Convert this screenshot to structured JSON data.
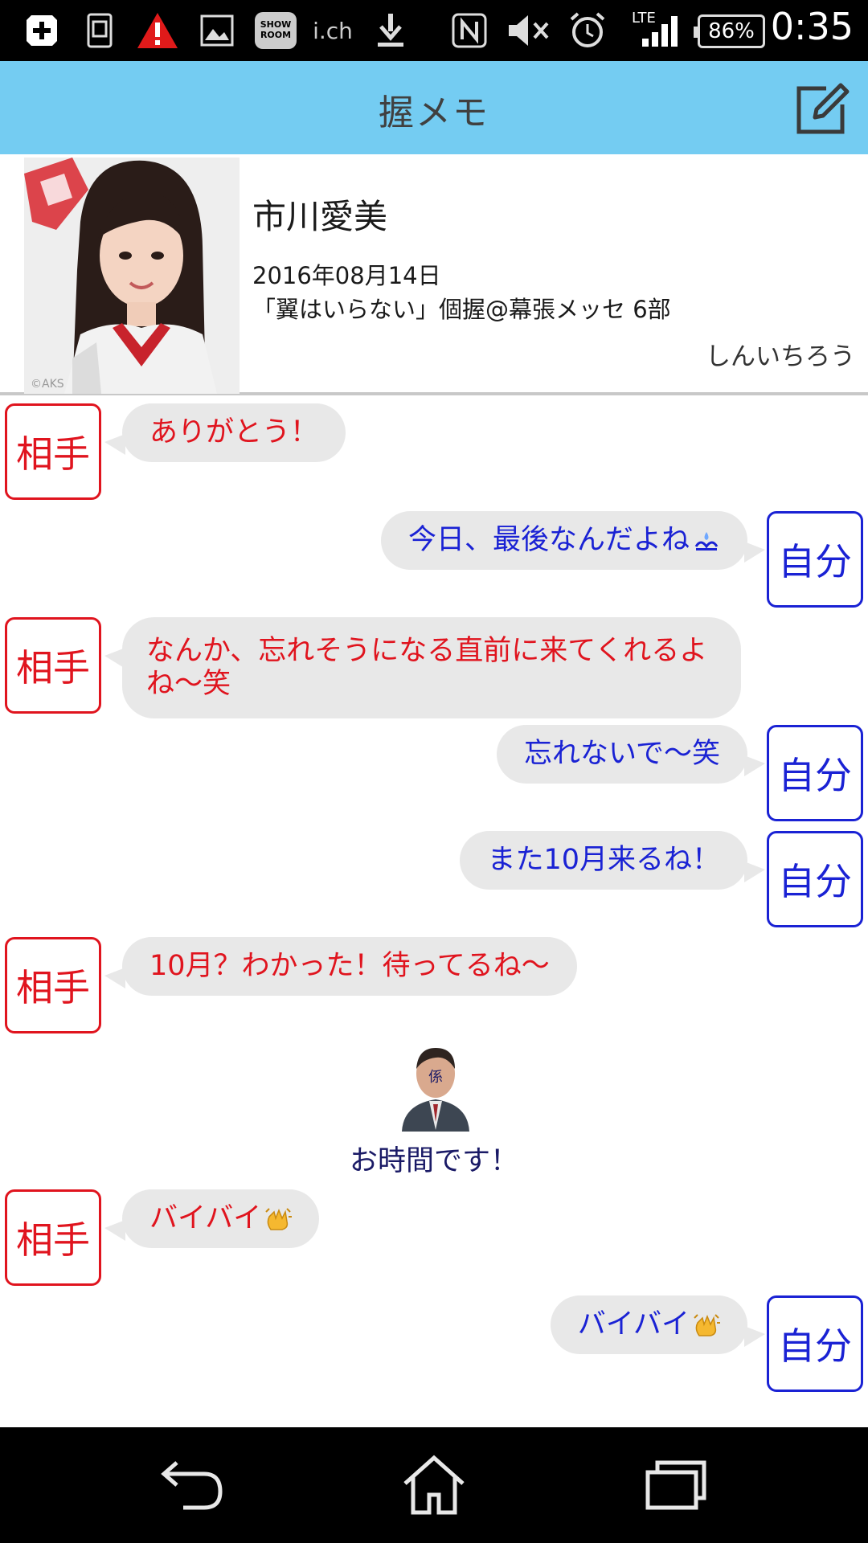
{
  "status_bar": {
    "time": "0:35",
    "battery": "86%",
    "network": "LTE",
    "icons": [
      "plus-notification-icon",
      "sim-icon",
      "warning-icon",
      "gallery-icon",
      "showroom-icon",
      "ich-icon",
      "download-icon",
      "nfc-icon",
      "mute-icon",
      "alarm-icon",
      "signal-icon",
      "battery-icon"
    ],
    "showroom_label": "SHOW ROOM",
    "ich_label": "i.ch"
  },
  "app_bar": {
    "title": "握メモ",
    "compose_icon": "compose-icon"
  },
  "profile": {
    "name": "市川愛美",
    "date": "2016年08月14日",
    "event": "「翼はいらない」個握@幕張メッセ 6部",
    "author": "しんいちろう",
    "photo_credit": "©AKS"
  },
  "labels": {
    "them": "相手",
    "me": "自分"
  },
  "messages": [
    {
      "who": "them",
      "text": "ありがとう！"
    },
    {
      "who": "me",
      "text": "今日、最後なんだよね",
      "emoji": "sweat-icon"
    },
    {
      "who": "them",
      "text": "なんか、忘れそうになる直前に来てくれるよね〜笑"
    },
    {
      "who": "me",
      "text": "忘れないで〜笑"
    },
    {
      "who": "me",
      "text": "また10月来るね！"
    },
    {
      "who": "them",
      "text": "10月？わかった！待ってるね〜"
    },
    {
      "who": "staff",
      "text": "お時間です！",
      "icon_label": "係"
    },
    {
      "who": "them",
      "text": "バイバイ",
      "emoji": "waving-hand-icon"
    },
    {
      "who": "me",
      "text": "バイバイ",
      "emoji": "waving-hand-icon"
    }
  ],
  "nav_bar": {
    "icons": [
      "back-icon",
      "home-icon",
      "recents-icon"
    ]
  },
  "colors": {
    "app_bar": "#74ccf2",
    "them": "#e0141e",
    "me": "#1a22d4",
    "bubble": "#e8e8e8"
  }
}
